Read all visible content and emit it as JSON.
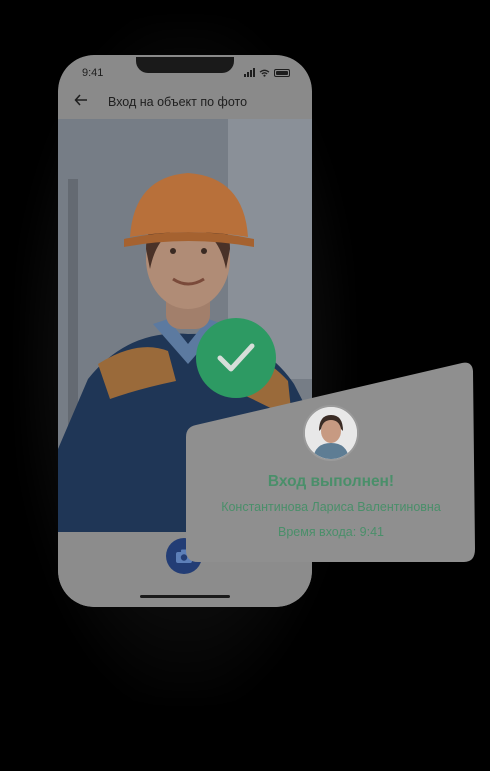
{
  "status_bar": {
    "time": "9:41"
  },
  "app_bar": {
    "title": "Вход на объект по фото",
    "back_icon": "arrow-left-icon"
  },
  "camera_button": {
    "icon": "camera-icon"
  },
  "success": {
    "check_icon": "checkmark-icon",
    "title": "Вход выполнен!",
    "name": "Константинова Лариса Валентиновна",
    "entry_time": "Время входа: 9:41"
  },
  "colors": {
    "success_green": "#2d9a63",
    "text_green": "#4a8f6a",
    "camera_blue": "#233d75"
  }
}
